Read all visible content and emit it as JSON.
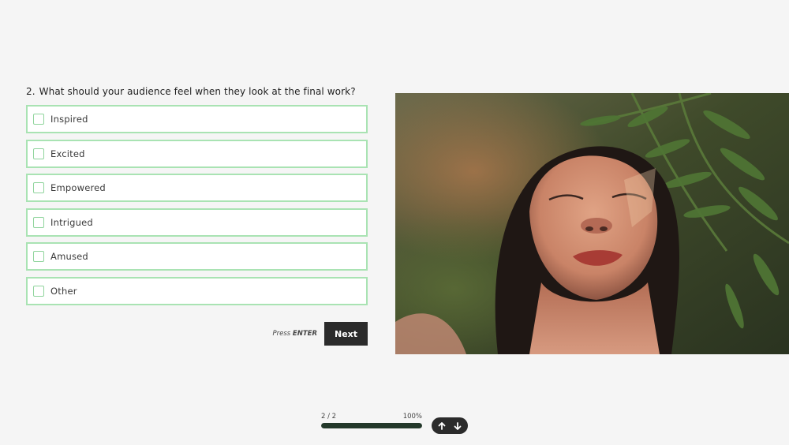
{
  "question": {
    "number": "2.",
    "text": "What should your audience feel when they look at the final work?"
  },
  "options": [
    {
      "label": "Inspired",
      "checked": false
    },
    {
      "label": "Excited",
      "checked": false
    },
    {
      "label": "Empowered",
      "checked": false
    },
    {
      "label": "Intrigued",
      "checked": false
    },
    {
      "label": "Amused",
      "checked": false
    },
    {
      "label": "Other",
      "checked": false
    }
  ],
  "submit": {
    "hint_prefix": "Press",
    "hint_key": "ENTER",
    "button_label": "Next"
  },
  "progress": {
    "position": "2 / 2",
    "percent_label": "100%",
    "fraction": 1.0
  },
  "navigation": {
    "up_icon": "arrow-up-icon",
    "down_icon": "arrow-down-icon"
  },
  "colors": {
    "option_border": "#a9e3b3",
    "button_bg": "#2b2b2b",
    "progress_fill": "#23382a",
    "background": "#f5f5f5"
  }
}
